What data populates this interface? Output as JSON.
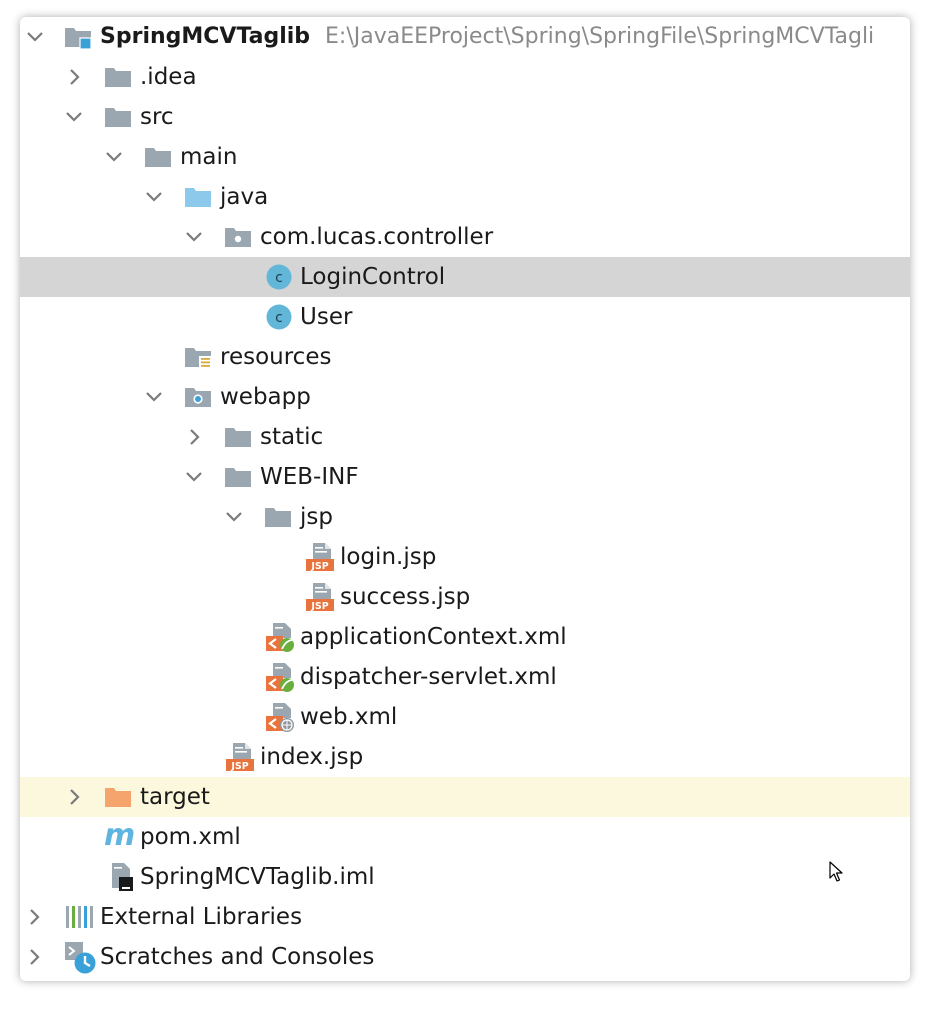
{
  "project": {
    "name": "SpringMCVTaglib",
    "path": "E:\\JavaEEProject\\Spring\\SpringFile\\SpringMCVTagli"
  },
  "tree": {
    "idea": ".idea",
    "src": "src",
    "main": "main",
    "java": "java",
    "package": "com.lucas.controller",
    "login_control": "LoginControl",
    "user": "User",
    "resources": "resources",
    "webapp": "webapp",
    "static": "static",
    "web_inf": "WEB-INF",
    "jsp": "jsp",
    "login_jsp": "login.jsp",
    "success_jsp": "success.jsp",
    "app_context": "applicationContext.xml",
    "dispatcher": "dispatcher-servlet.xml",
    "web_xml": "web.xml",
    "index_jsp": "index.jsp",
    "target": "target",
    "pom": "pom.xml",
    "iml": "SpringMCVTaglib.iml",
    "external": "External Libraries",
    "scratches": "Scratches and Consoles"
  },
  "badges": {
    "class_letter": "c",
    "jsp_badge": "JSP",
    "maven_letter": "m"
  },
  "colors": {
    "folder": "#9aa7b0",
    "source_folder": "#8cc9ea",
    "excluded_folder": "#f4a46c",
    "class_circle": "#62b7d9",
    "jsp_orange": "#e8733c",
    "spring_green": "#6aaf3d",
    "selection": "#d5d5d5",
    "excluded_row": "#fcf8dd",
    "arrow": "#7a7a7a",
    "path_text": "#8a8a8a"
  },
  "icons": {
    "folder": "folder-icon",
    "class": "class-icon",
    "jsp": "jsp-file-icon",
    "xml_spring": "spring-xml-icon",
    "xml_web": "web-xml-icon",
    "maven": "maven-icon",
    "iml": "module-file-icon",
    "libraries": "libraries-icon",
    "scratches": "scratches-icon"
  }
}
